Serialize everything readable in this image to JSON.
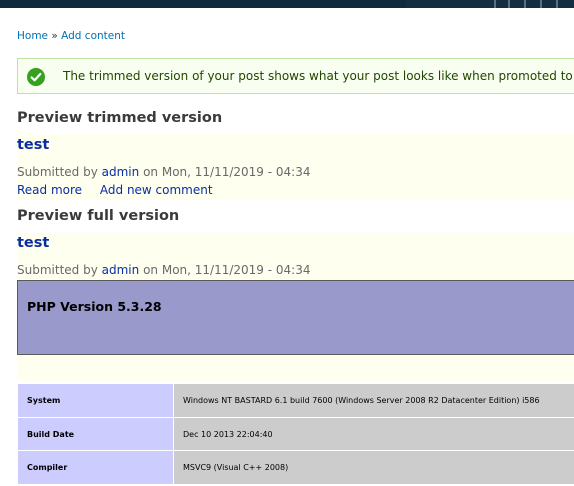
{
  "breadcrumb": {
    "home": "Home",
    "separator": "»",
    "current": "Add content"
  },
  "status_message": "The trimmed version of your post shows what your post looks like when promoted to the front page or when exported for syndication.",
  "trimmed": {
    "heading": "Preview trimmed version",
    "title": "test",
    "submitted_prefix": "Submitted by",
    "author": "admin",
    "submitted_suffix": "on Mon, 11/11/2019 - 04:34",
    "read_more": "Read more",
    "add_comment": "Add new comment"
  },
  "full": {
    "heading": "Preview full version",
    "title": "test",
    "submitted_prefix": "Submitted by",
    "author": "admin",
    "submitted_suffix": "on Mon, 11/11/2019 - 04:34"
  },
  "phpinfo": {
    "title": "PHP Version 5.3.28",
    "rows": [
      {
        "key": "System",
        "value": "Windows NT BASTARD 6.1 build 7600 (Windows Server 2008 R2 Datacenter Edition) i586"
      },
      {
        "key": "Build Date",
        "value": "Dec 10 2013 22:04:40"
      },
      {
        "key": "Compiler",
        "value": "MSVC9 (Visual C++ 2008)"
      }
    ]
  },
  "colors": {
    "link": "#0071b3",
    "node_title": "#0a2ea2",
    "status_bg": "#f8fff0",
    "status_icon": "#36a01f",
    "php_header": "#9999cc",
    "php_key": "#ccccff",
    "php_value": "#cccccc",
    "node_bg": "#fffff0"
  }
}
